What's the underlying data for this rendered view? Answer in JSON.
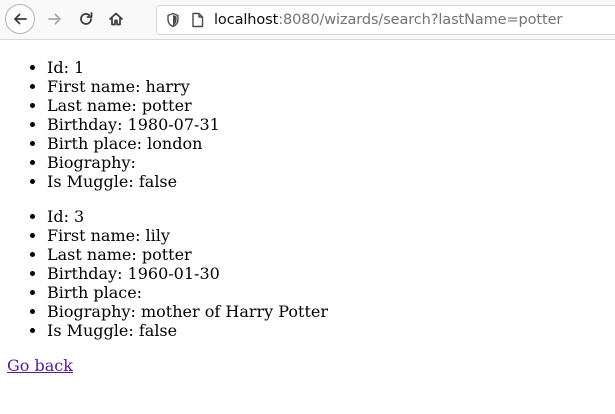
{
  "browser": {
    "url_host": "localhost",
    "url_rest": ":8080/wizards/search?lastName=potter"
  },
  "wizards": [
    {
      "id": "Id: 1",
      "first_name": "First name: harry",
      "last_name": "Last name: potter",
      "birthday": "Birthday: 1980-07-31",
      "birth_place": "Birth place: london",
      "biography": "Biography:",
      "is_muggle": "Is Muggle: false"
    },
    {
      "id": "Id: 3",
      "first_name": "First name: lily",
      "last_name": "Last name: potter",
      "birthday": "Birthday: 1960-01-30",
      "birth_place": "Birth place:",
      "biography": "Biography: mother of Harry Potter",
      "is_muggle": "Is Muggle: false"
    }
  ],
  "go_back_label": "Go back",
  "icons": {
    "back": "back-arrow-icon",
    "forward": "forward-arrow-icon",
    "reload": "reload-icon",
    "home": "home-icon",
    "shield": "tracking-shield-icon",
    "page": "page-info-icon"
  },
  "colors": {
    "link_visited": "#551a8b",
    "toolbar_bg": "#f9f9fa"
  }
}
